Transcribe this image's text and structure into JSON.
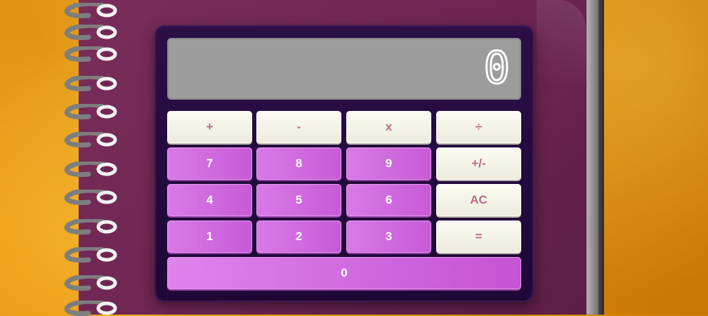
{
  "display": {
    "value": "0"
  },
  "keys": {
    "plus": "+",
    "minus": "-",
    "multiply": "x",
    "divide": "÷",
    "seven": "7",
    "eight": "8",
    "nine": "9",
    "sign": "+/-",
    "four": "4",
    "five": "5",
    "six": "6",
    "clear": "AC",
    "one": "1",
    "two": "2",
    "three": "3",
    "equals": "=",
    "zero": "0"
  },
  "colors": {
    "notebook": "#6d2552",
    "calculator_body": "#240b3f",
    "display_bg": "#9c9c9c",
    "operator_key": "#f3f2e6",
    "operator_text": "#c06889",
    "number_key": "#d06ae0",
    "background": "#e99a12"
  }
}
